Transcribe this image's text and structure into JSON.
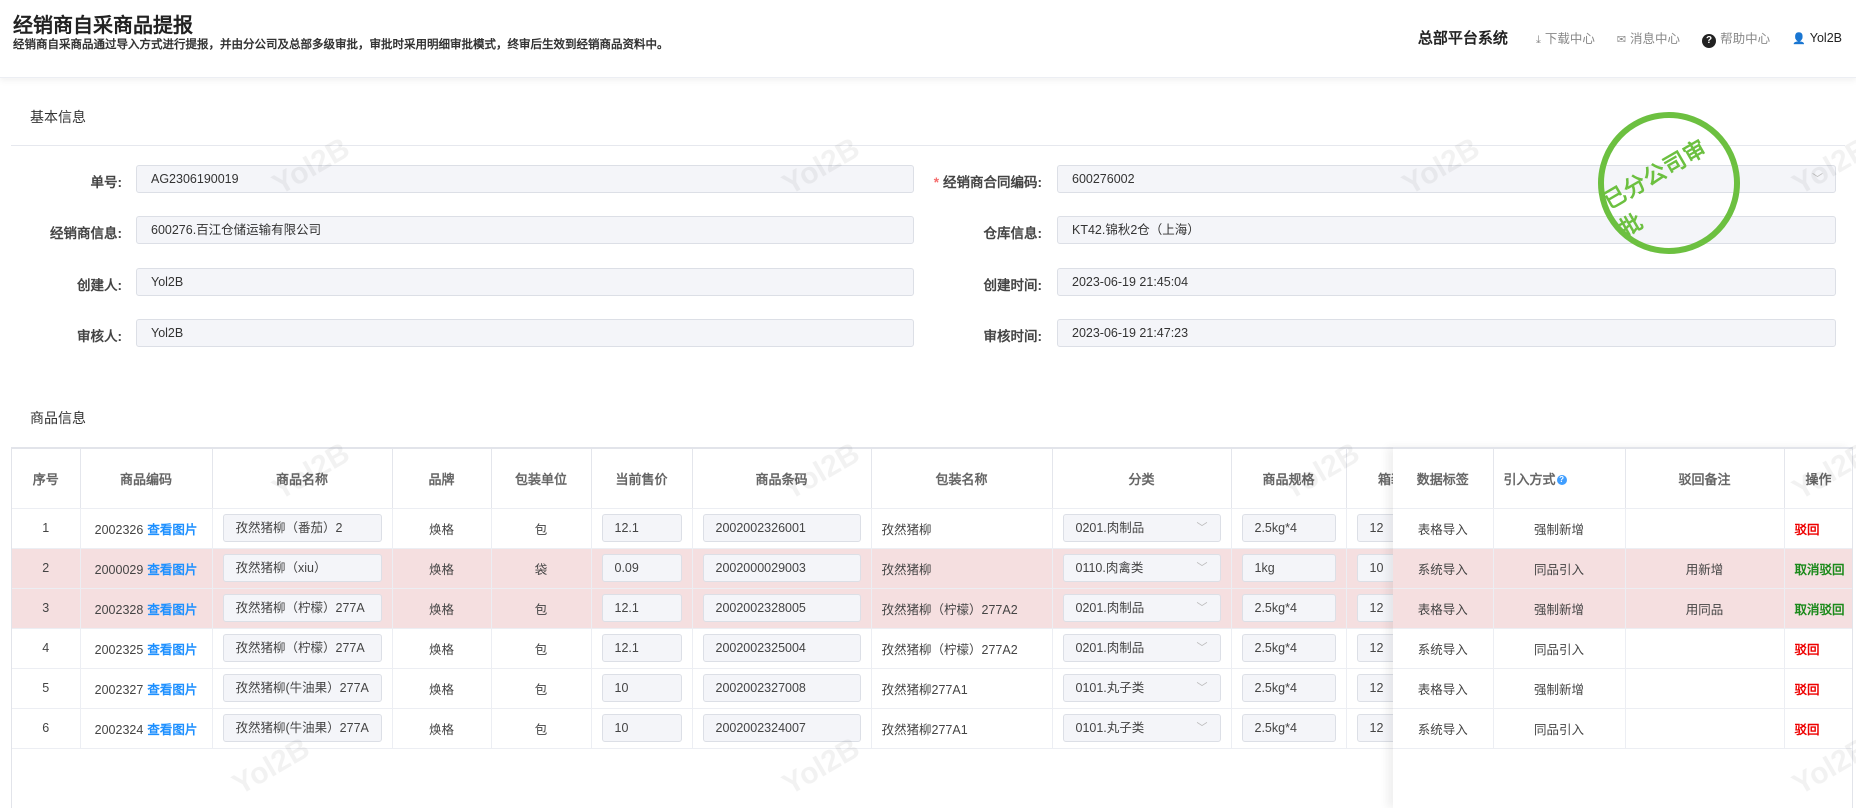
{
  "header": {
    "title": "经销商自采商品提报",
    "subtitle": "经销商自采商品通过导入方式进行提报，并由分公司及总部多级审批，审批时采用明细审批模式，终审后生效到经销商品资料中。",
    "system": "总部平台系统",
    "download": "下载中心",
    "messages": "消息中心",
    "help": "帮助中心",
    "user": "Yol2B"
  },
  "basic": {
    "section_title": "基本信息",
    "order_no_label": "单号:",
    "order_no": "AG2306190019",
    "contract_label": "经销商合同编码:",
    "contract": "600276002",
    "dealer_label": "经销商信息:",
    "dealer": "600276.百江仓储运输有限公司",
    "warehouse_label": "仓库信息:",
    "warehouse": "KT42.锦秋2仓（上海）",
    "creator_label": "创建人:",
    "creator": "Yol2B",
    "created_label": "创建时间:",
    "created": "2023-06-19 21:45:04",
    "reviewer_label": "审核人:",
    "reviewer": "Yol2B",
    "reviewed_label": "审核时间:",
    "reviewed": "2023-06-19 21:47:23"
  },
  "stamp": "已分公司审批",
  "watermark": "Yol2B",
  "goods": {
    "section_title": "商品信息",
    "view_image": "查看图片",
    "columns": [
      "序号",
      "商品编码",
      "商品名称",
      "品牌",
      "包装单位",
      "当前售价",
      "商品条码",
      "包装名称",
      "分类",
      "商品规格",
      "箱装数量"
    ],
    "fixed_columns": [
      "数据标签",
      "引入方式",
      "驳回备注",
      "操作"
    ],
    "rows": [
      {
        "no": "1",
        "code": "2002326",
        "name": "孜然猪柳（番茄）2",
        "brand": "焕格",
        "unit": "包",
        "price": "12.1",
        "barcode": "2002002326001",
        "pack": "孜然猪柳",
        "category": "0201.肉制品",
        "spec": "2.5kg*4",
        "qty": "12",
        "tag": "表格导入",
        "method": "强制新增",
        "remark": "",
        "action": "驳回",
        "rejected": false
      },
      {
        "no": "2",
        "code": "2000029",
        "name": "孜然猪柳（xiu）",
        "brand": "焕格",
        "unit": "袋",
        "price": "0.09",
        "barcode": "2002000029003",
        "pack": "孜然猪柳",
        "category": "0110.肉禽类",
        "spec": "1kg",
        "qty": "10",
        "tag": "系统导入",
        "method": "同品引入",
        "remark": "用新增",
        "action": "取消驳回",
        "rejected": true
      },
      {
        "no": "3",
        "code": "2002328",
        "name": "孜然猪柳（柠檬）277A",
        "brand": "焕格",
        "unit": "包",
        "price": "12.1",
        "barcode": "2002002328005",
        "pack": "孜然猪柳（柠檬）277A2",
        "category": "0201.肉制品",
        "spec": "2.5kg*4",
        "qty": "12",
        "tag": "表格导入",
        "method": "强制新增",
        "remark": "用同品",
        "action": "取消驳回",
        "rejected": true
      },
      {
        "no": "4",
        "code": "2002325",
        "name": "孜然猪柳（柠檬）277A",
        "brand": "焕格",
        "unit": "包",
        "price": "12.1",
        "barcode": "2002002325004",
        "pack": "孜然猪柳（柠檬）277A2",
        "category": "0201.肉制品",
        "spec": "2.5kg*4",
        "qty": "12",
        "tag": "系统导入",
        "method": "同品引入",
        "remark": "",
        "action": "驳回",
        "rejected": false
      },
      {
        "no": "5",
        "code": "2002327",
        "name": "孜然猪柳(牛油果）277A",
        "brand": "焕格",
        "unit": "包",
        "price": "10",
        "barcode": "2002002327008",
        "pack": "孜然猪柳277A1",
        "category": "0101.丸子类",
        "spec": "2.5kg*4",
        "qty": "12",
        "tag": "表格导入",
        "method": "强制新增",
        "remark": "",
        "action": "驳回",
        "rejected": false
      },
      {
        "no": "6",
        "code": "2002324",
        "name": "孜然猪柳(牛油果）277A",
        "brand": "焕格",
        "unit": "包",
        "price": "10",
        "barcode": "2002002324007",
        "pack": "孜然猪柳277A1",
        "category": "0101.丸子类",
        "spec": "2.5kg*4",
        "qty": "12",
        "tag": "系统导入",
        "method": "同品引入",
        "remark": "",
        "action": "驳回",
        "rejected": false
      }
    ]
  },
  "colors": {
    "accent": "#1e90ff",
    "stamp": "#6cc040",
    "reject": "#ee0000",
    "cancel": "#1a8a1a",
    "rejected_row": "#f5dfe0"
  }
}
